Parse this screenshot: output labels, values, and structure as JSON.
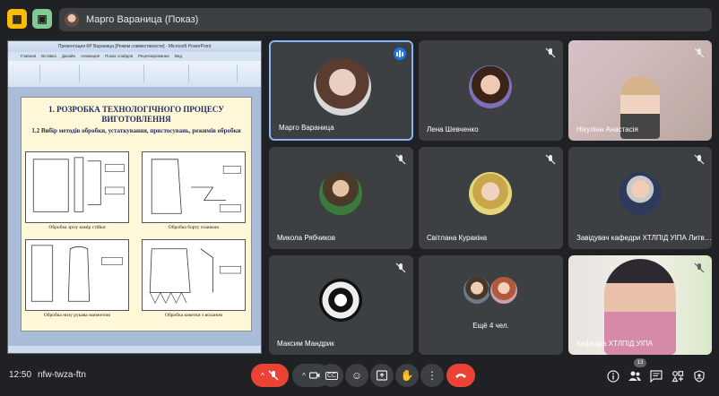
{
  "header": {
    "presenter_text": "Марго Вараница (Показ)"
  },
  "presentation": {
    "window_title": "Презентация КР Вараница [Режим совместимости] - Microsoft PowerPoint",
    "tabs": [
      "Главная",
      "Вставка",
      "Дизайн",
      "Анимация",
      "Показ слайдов",
      "Рецензирование",
      "Вид"
    ],
    "slide_title_line1": "1. РОЗРОБКА ТЕХНОЛОГІЧНОГО ПРОЦЕСУ",
    "slide_title_line2": "ВИГОТОВЛЕННЯ",
    "slide_subtitle": "1.2 Вибір методів обробки, устаткування, пристосувань, режимів обробки",
    "captions": [
      "Обробка зрізу комір стійки",
      "Обробка борту планкою",
      "Обробка низу рукава манжетою",
      "Обробка кокетки з воланом"
    ]
  },
  "participants": [
    {
      "name": "Марго Вараница",
      "status": "speaking"
    },
    {
      "name": "Лена Шевченко",
      "status": "muted"
    },
    {
      "name": "Нікуліна Анастасія",
      "status": "muted"
    },
    {
      "name": "Микола Рябчиков",
      "status": "muted"
    },
    {
      "name": "Світлана Куракіна",
      "status": "muted"
    },
    {
      "name": "Завідувач кафедри ХТЛПІД УІПА Литв…",
      "status": "muted"
    },
    {
      "name": "Максим Мандрик",
      "status": "muted"
    },
    {
      "name": "Ещё 4 чел.",
      "status": "group"
    },
    {
      "name": "Кафедра ХТЛПІД УІПА",
      "status": "muted"
    }
  ],
  "footer": {
    "time": "12:50",
    "meeting_code": "nfw-twza-ftn",
    "people_count": "13"
  },
  "colors": {
    "background": "#202124",
    "tile": "#3c4043",
    "accent": "#8ab4f8",
    "end_call": "#ea4335"
  }
}
